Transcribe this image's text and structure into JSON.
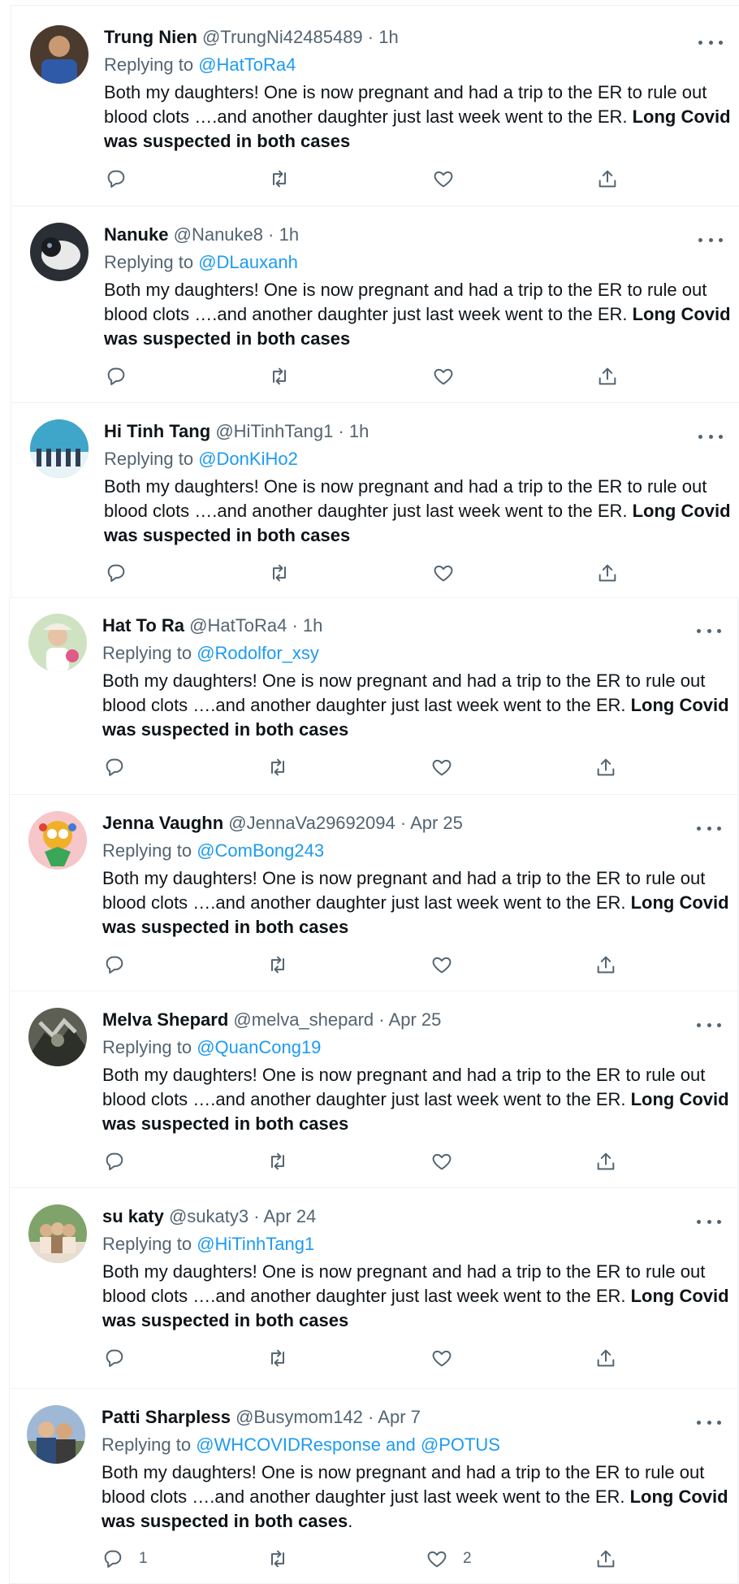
{
  "colors": {
    "link": "#1d9bf0",
    "muted": "#536471",
    "text": "#0f1419"
  },
  "icons": [
    "reply-icon",
    "retweet-icon",
    "like-icon",
    "share-icon",
    "more-icon"
  ],
  "tweets": [
    {
      "name": "Trung Nien",
      "handle": "@TrungNi42485489",
      "dot": "·",
      "time": "1h",
      "reply_prefix": "Replying to",
      "reply_to": "@HatToRa4",
      "text_plain": "Both my daughters! One is now pregnant and had a trip to the ER to rule out blood clots ….and another daughter just last week went to the ER. ",
      "text_bold": "Long Covid was suspected in both cases",
      "text_suffix": "",
      "reply_count": "",
      "like_count": ""
    },
    {
      "name": "Nanuke",
      "handle": "@Nanuke8",
      "dot": "·",
      "time": "1h",
      "reply_prefix": "Replying to",
      "reply_to": "@DLauxanh",
      "text_plain": "Both my daughters! One is now pregnant and had a trip to the ER to rule out blood clots ….and another daughter just last week went to the ER. ",
      "text_bold": "Long Covid was suspected in both cases",
      "text_suffix": "",
      "reply_count": "",
      "like_count": ""
    },
    {
      "name": "Hi Tinh Tang",
      "handle": "@HiTinhTang1",
      "dot": "·",
      "time": "1h",
      "reply_prefix": "Replying to",
      "reply_to": "@DonKiHo2",
      "text_plain": "Both my daughters! One is now pregnant and had a trip to the ER to rule out blood clots ….and another daughter just last week went to the ER. ",
      "text_bold": "Long Covid was suspected in both cases",
      "text_suffix": "",
      "reply_count": "",
      "like_count": ""
    },
    {
      "name": "Hat To Ra",
      "handle": "@HatToRa4",
      "dot": "·",
      "time": "1h",
      "reply_prefix": "Replying to",
      "reply_to": "@Rodolfor_xsy",
      "text_plain": "Both my daughters! One is now pregnant and had a trip to the ER to rule out blood clots ….and another daughter just last week went to the ER. ",
      "text_bold": "Long Covid was suspected in both cases",
      "text_suffix": "",
      "reply_count": "",
      "like_count": ""
    },
    {
      "name": "Jenna Vaughn",
      "handle": "@JennaVa29692094",
      "dot": "·",
      "time": "Apr 25",
      "reply_prefix": "Replying to",
      "reply_to": "@ComBong243",
      "text_plain": "Both my daughters! One is now pregnant and had a trip to the ER to rule out blood clots ….and another daughter just last week went to the ER. ",
      "text_bold": "Long Covid was suspected in both cases",
      "text_suffix": "",
      "reply_count": "",
      "like_count": ""
    },
    {
      "name": "Melva Shepard",
      "handle": "@melva_shepard",
      "dot": "·",
      "time": "Apr 25",
      "reply_prefix": "Replying to",
      "reply_to": "@QuanCong19",
      "text_plain": "Both my daughters! One is now pregnant and had a trip to the ER to rule out blood clots ….and another daughter just last week went to the ER. ",
      "text_bold": "Long Covid was suspected in both cases",
      "text_suffix": "",
      "reply_count": "",
      "like_count": ""
    },
    {
      "name": "su katy",
      "handle": "@sukaty3",
      "dot": "·",
      "time": "Apr 24",
      "reply_prefix": "Replying to",
      "reply_to": "@HiTinhTang1",
      "text_plain": "Both my daughters! One is now pregnant and had a trip to the ER to rule out blood clots ….and another daughter just last week went to the ER. ",
      "text_bold": "Long Covid was suspected in both cases",
      "text_suffix": "",
      "reply_count": "",
      "like_count": ""
    },
    {
      "name": "Patti Sharpless",
      "handle": "@Busymom142",
      "dot": "·",
      "time": "Apr 7",
      "reply_prefix": "Replying to",
      "reply_to": "@WHCOVIDResponse and @POTUS",
      "text_plain": "Both my daughters!  One is now pregnant and had a trip to the ER to rule out blood clots ….and another daughter just last week went to the ER. ",
      "text_bold": "Long Covid was suspected in both cases",
      "text_suffix": ".",
      "reply_count": "1",
      "like_count": "2"
    }
  ]
}
